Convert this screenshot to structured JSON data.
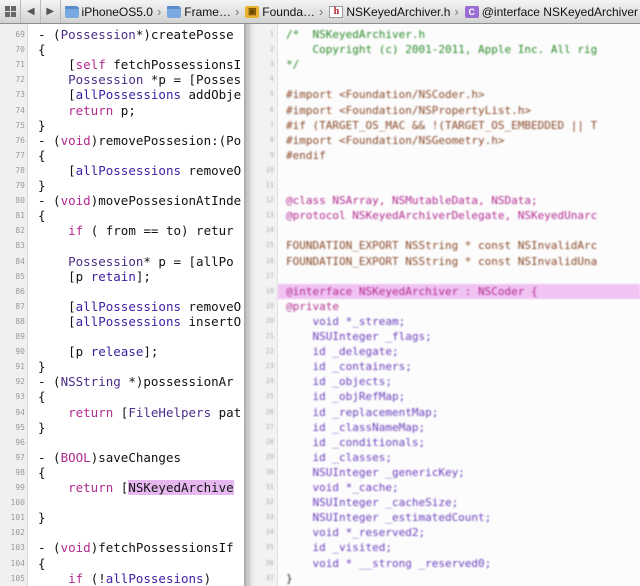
{
  "breadcrumb": [
    {
      "icon": "folder-icon",
      "label": "iPhoneOS5.0"
    },
    {
      "icon": "folder-icon",
      "label": "Frame…"
    },
    {
      "icon": "framework-icon",
      "label": "Founda…"
    },
    {
      "icon": "header-file-icon",
      "label": "NSKeyedArchiver.h"
    },
    {
      "icon": "class-icon",
      "label": "@interface NSKeyedArchiver"
    }
  ],
  "left_editor": {
    "lines": [
      {
        "n": "69",
        "text": "- (Possession*)createPosse"
      },
      {
        "n": "70",
        "text": "{"
      },
      {
        "n": "71",
        "text": "    [self fetchPossessionsI"
      },
      {
        "n": "72",
        "text": "    Possession *p = [Posses"
      },
      {
        "n": "73",
        "text": "    [allPossessions addObje"
      },
      {
        "n": "74",
        "text": "    return p;"
      },
      {
        "n": "75",
        "text": "}"
      },
      {
        "n": "76",
        "text": "- (void)removePossesion:(Po"
      },
      {
        "n": "77",
        "text": "{"
      },
      {
        "n": "78",
        "text": "    [allPossessions removeO"
      },
      {
        "n": "79",
        "text": "}"
      },
      {
        "n": "80",
        "text": "- (void)movePossesionAtInde"
      },
      {
        "n": "81",
        "text": "{"
      },
      {
        "n": "82",
        "text": "    if ( from == to) retur"
      },
      {
        "n": "83",
        "text": ""
      },
      {
        "n": "84",
        "text": "    Possession* p = [allPo"
      },
      {
        "n": "85",
        "text": "    [p retain];"
      },
      {
        "n": "86",
        "text": ""
      },
      {
        "n": "87",
        "text": "    [allPossessions removeO"
      },
      {
        "n": "88",
        "text": "    [allPossessions insertO"
      },
      {
        "n": "89",
        "text": ""
      },
      {
        "n": "90",
        "text": "    [p release];"
      },
      {
        "n": "91",
        "text": "}"
      },
      {
        "n": "92",
        "text": "- (NSString *)possessionAr"
      },
      {
        "n": "93",
        "text": "{"
      },
      {
        "n": "94",
        "text": "    return [FileHelpers pat"
      },
      {
        "n": "95",
        "text": "}"
      },
      {
        "n": "96",
        "text": ""
      },
      {
        "n": "97",
        "text": "- (BOOL)saveChanges"
      },
      {
        "n": "98",
        "text": "{"
      },
      {
        "n": "99",
        "text": "    return [NSKeyedArchive"
      },
      {
        "n": "100",
        "text": ""
      },
      {
        "n": "101",
        "text": "}"
      },
      {
        "n": "102",
        "text": ""
      },
      {
        "n": "103",
        "text": "- (void)fetchPossessionsIf"
      },
      {
        "n": "104",
        "text": "{"
      },
      {
        "n": "105",
        "text": "    if (!allPossesions)"
      }
    ]
  },
  "right_editor": {
    "lines": [
      {
        "n": "1",
        "text": "/*  NSKeyedArchiver.h",
        "cls": "c-comment"
      },
      {
        "n": "2",
        "text": "    Copyright (c) 2001-2011, Apple Inc. All rig",
        "cls": "c-comment"
      },
      {
        "n": "3",
        "text": "*/",
        "cls": "c-comment"
      },
      {
        "n": "4",
        "text": "",
        "cls": ""
      },
      {
        "n": "5",
        "text": "#import <Foundation/NSCoder.h>",
        "cls": "c-pre"
      },
      {
        "n": "6",
        "text": "#import <Foundation/NSPropertyList.h>",
        "cls": "c-pre"
      },
      {
        "n": "7",
        "text": "#if (TARGET_OS_MAC && !(TARGET_OS_EMBEDDED || T",
        "cls": "c-pre"
      },
      {
        "n": "8",
        "text": "#import <Foundation/NSGeometry.h>",
        "cls": "c-pre"
      },
      {
        "n": "9",
        "text": "#endif",
        "cls": "c-pre"
      },
      {
        "n": "10",
        "text": "",
        "cls": ""
      },
      {
        "n": "11",
        "text": "",
        "cls": ""
      },
      {
        "n": "12",
        "text": "@class NSArray, NSMutableData, NSData;",
        "cls": "c-kw"
      },
      {
        "n": "13",
        "text": "@protocol NSKeyedArchiverDelegate, NSKeyedUnarc",
        "cls": "c-kw"
      },
      {
        "n": "14",
        "text": "",
        "cls": ""
      },
      {
        "n": "15",
        "text": "FOUNDATION_EXPORT NSString * const NSInvalidArc",
        "cls": "c-pre"
      },
      {
        "n": "16",
        "text": "FOUNDATION_EXPORT NSString * const NSInvalidUna",
        "cls": "c-pre"
      },
      {
        "n": "17",
        "text": "",
        "cls": ""
      },
      {
        "n": "18",
        "text": "@interface NSKeyedArchiver : NSCoder {",
        "cls": "c-kw",
        "hl": true
      },
      {
        "n": "19",
        "text": "@private",
        "cls": "c-kw"
      },
      {
        "n": "20",
        "text": "    void *_stream;",
        "cls": "c-type"
      },
      {
        "n": "21",
        "text": "    NSUInteger _flags;",
        "cls": "c-type"
      },
      {
        "n": "22",
        "text": "    id _delegate;",
        "cls": "c-type"
      },
      {
        "n": "23",
        "text": "    id _containers;",
        "cls": "c-type"
      },
      {
        "n": "24",
        "text": "    id _objects;",
        "cls": "c-type"
      },
      {
        "n": "25",
        "text": "    id _objRefMap;",
        "cls": "c-type"
      },
      {
        "n": "26",
        "text": "    id _replacementMap;",
        "cls": "c-type"
      },
      {
        "n": "27",
        "text": "    id _classNameMap;",
        "cls": "c-type"
      },
      {
        "n": "28",
        "text": "    id _conditionals;",
        "cls": "c-type"
      },
      {
        "n": "29",
        "text": "    id _classes;",
        "cls": "c-type"
      },
      {
        "n": "30",
        "text": "    NSUInteger _genericKey;",
        "cls": "c-type"
      },
      {
        "n": "31",
        "text": "    void *_cache;",
        "cls": "c-type"
      },
      {
        "n": "32",
        "text": "    NSUInteger _cacheSize;",
        "cls": "c-type"
      },
      {
        "n": "33",
        "text": "    NSUInteger _estimatedCount;",
        "cls": "c-type"
      },
      {
        "n": "34",
        "text": "    void *_reserved2;",
        "cls": "c-type"
      },
      {
        "n": "35",
        "text": "    id _visited;",
        "cls": "c-type"
      },
      {
        "n": "36",
        "text": "    void * __strong _reserved0;",
        "cls": "c-type"
      },
      {
        "n": "37",
        "text": "}",
        "cls": ""
      }
    ]
  },
  "colors": {
    "keyword": "#b22a8f",
    "highlight": "#e7b8f0",
    "comment": "#2a8a2a",
    "preprocessor": "#8a4a2a"
  }
}
